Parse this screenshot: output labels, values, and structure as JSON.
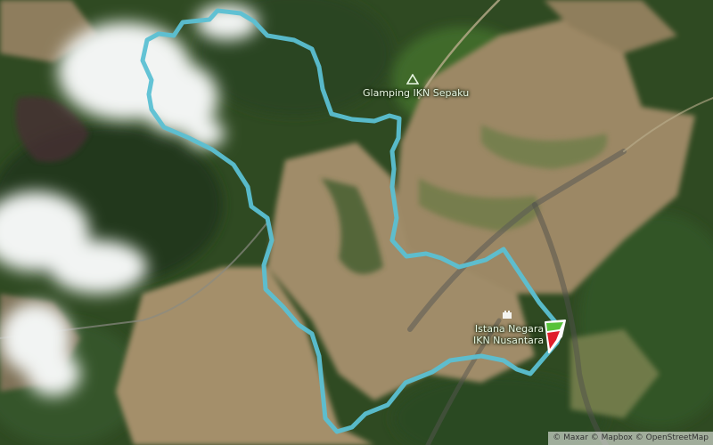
{
  "map": {
    "type": "satellite-route-map",
    "labels": {
      "glamping": "Glamping IKN Sepaku",
      "istana_line1": "Istana Negara",
      "istana_line2": "IKN Nusantara"
    },
    "icons": {
      "glamping": "campsite-triangle-icon",
      "istana": "landmark-castle-icon",
      "marker": "start-finish-flag-marker-icon"
    },
    "attribution": "© Maxar © Mapbox © OpenStreetMap",
    "colors": {
      "route": "#5bc0d3",
      "forest": "#2e4a21",
      "cleared_land": "#9a8663",
      "marker_green": "#58c23a",
      "marker_red": "#e01e2b"
    }
  }
}
